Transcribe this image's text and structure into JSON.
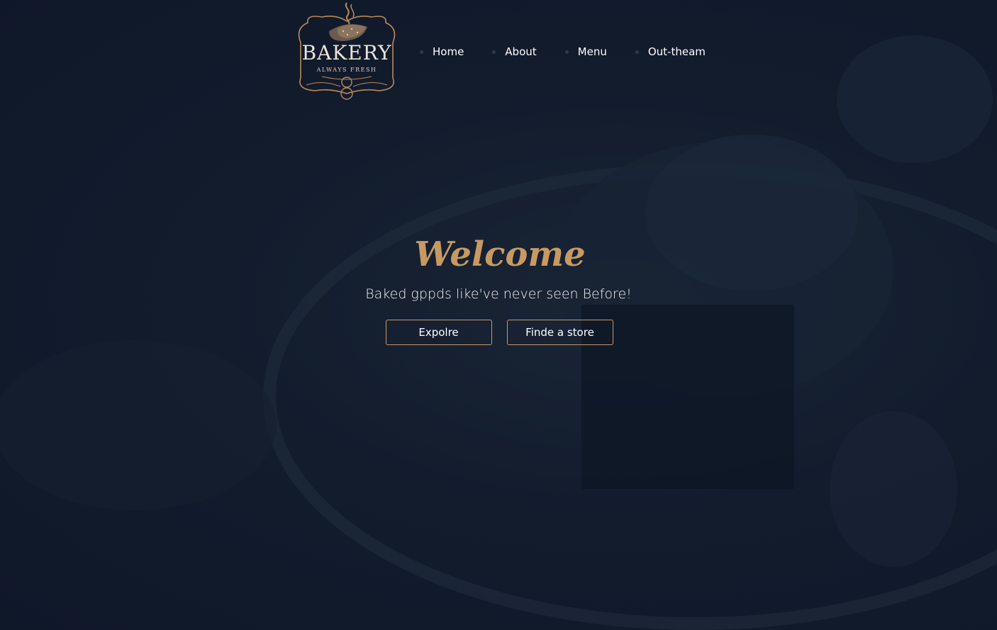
{
  "logo": {
    "title": "BAKERY",
    "subtitle": "ALWAYS FRESH",
    "accent_color": "#c79a63"
  },
  "nav": {
    "items": [
      {
        "label": "Home"
      },
      {
        "label": "About"
      },
      {
        "label": "Menu"
      },
      {
        "label": "Out-theam"
      }
    ]
  },
  "hero": {
    "title": "Welcome",
    "subtitle": "Baked gppds like've never seen Before!",
    "buttons": {
      "explore": "Expolre",
      "find_store": "Finde a store"
    }
  },
  "colors": {
    "background": "#101a2b",
    "accent": "#c79a63",
    "text": "#ffffff"
  }
}
